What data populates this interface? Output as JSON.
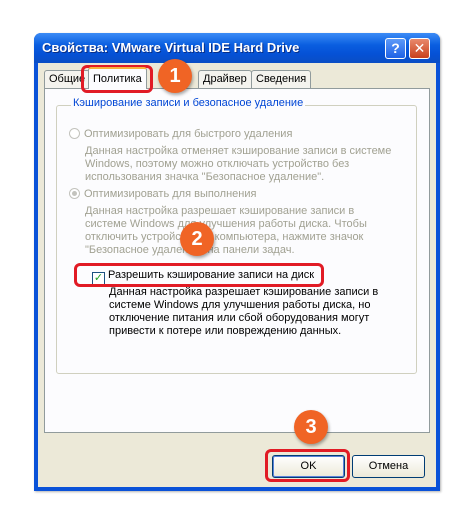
{
  "window": {
    "title": "Свойства: VMware Virtual IDE Hard Drive",
    "help_label": "?",
    "close_label": "✕"
  },
  "tabs": [
    {
      "label": "Общие"
    },
    {
      "label": "Политика"
    },
    {
      "label": "Драйвер"
    },
    {
      "label": "Сведения"
    }
  ],
  "group": {
    "title": "Кэширование записи и безопасное удаление"
  },
  "options": {
    "quick_removal": {
      "label": "Оптимизировать для быстрого удаления",
      "selected": false,
      "desc": [
        "Данная настройка отменяет кэширование записи в системе",
        "Windows, поэтому можно отключать устройство без",
        "использования значка \"Безопасное удаление\"."
      ]
    },
    "performance": {
      "label": "Оптимизировать для выполнения",
      "selected": true,
      "desc": [
        "Данная настройка разрешает кэширование записи в",
        "системе Windows для улучшения работы диска. Чтобы",
        "отключить устройство от компьютера, нажмите значок",
        "\"Безопасное удаление\" на панели задач."
      ]
    },
    "write_cache": {
      "label": "Разрешить кэширование записи на диск",
      "checked": true,
      "desc": [
        "Данная настройка разрешает кэширование записи в",
        "системе Windows для улучшения работы диска, но",
        "отключение питания или сбой оборудования могут",
        "привести к потере или повреждению данных."
      ]
    }
  },
  "buttons": {
    "ok": "OK",
    "cancel": "Отмена"
  },
  "markers": [
    "1",
    "2",
    "3"
  ],
  "colors": {
    "titlebar": "#0a5ee0",
    "highlight": "#e11b25",
    "marker": "#f06425",
    "dialog_bg": "#ece9d8"
  }
}
